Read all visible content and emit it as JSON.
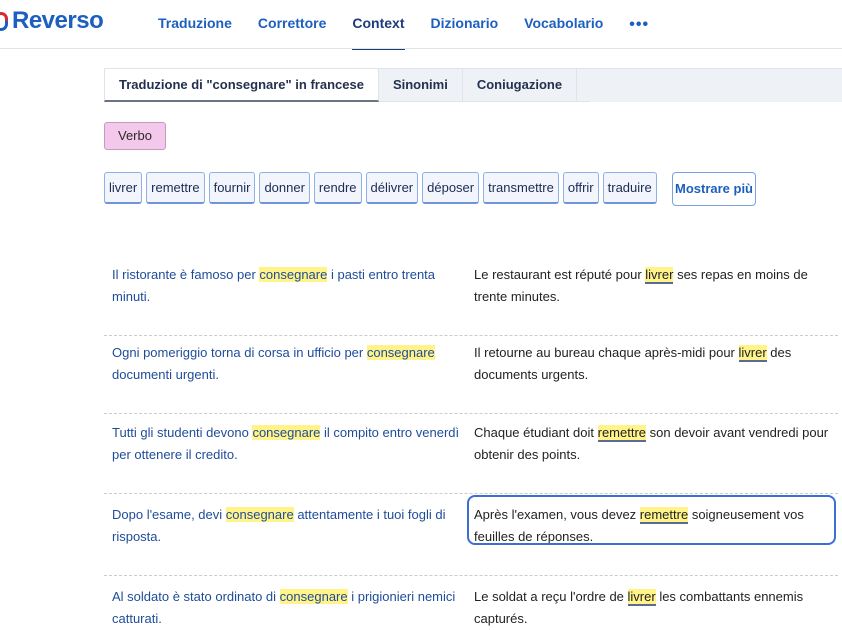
{
  "brand": {
    "name": "Reverso"
  },
  "nav": {
    "items": [
      "Traduzione",
      "Correttore",
      "Context",
      "Dizionario",
      "Vocabolario"
    ],
    "active": "Context",
    "more_label": "•••"
  },
  "subtabs": {
    "items": [
      "Traduzione di \"consegnare\" in francese",
      "Sinonimi",
      "Coniugazione"
    ],
    "more_label": "···"
  },
  "pos_label": "Verbo",
  "translations": [
    "livrer",
    "remettre",
    "fournir",
    "donner",
    "rendre",
    "délivrer",
    "déposer",
    "transmettre",
    "offrir",
    "traduire"
  ],
  "more_button": "Mostrare più",
  "examples": [
    {
      "src_before": "Il ristorante è famoso per ",
      "src_term": "consegnare",
      "src_after": " i pasti entro trenta minuti.",
      "trg_before": "Le restaurant est réputé pour ",
      "trg_term": "livrer",
      "trg_after": " ses repas en moins de trente minutes."
    },
    {
      "src_before": "Ogni pomeriggio torna di corsa in ufficio per ",
      "src_term": "consegnare",
      "src_after": " documenti urgenti.",
      "trg_before": "Il retourne au bureau chaque après-midi pour ",
      "trg_term": "livrer",
      "trg_after": " des documents urgents."
    },
    {
      "src_before": "Tutti gli studenti devono ",
      "src_term": "consegnare",
      "src_after": " il compito entro venerdì per ottenere il credito.",
      "trg_before": "Chaque étudiant doit ",
      "trg_term": "remettre",
      "trg_after": " son devoir avant vendredi pour obtenir des points."
    },
    {
      "src_before": "Dopo l'esame, devi ",
      "src_term": "consegnare",
      "src_after": " attentamente i tuoi fogli di risposta.",
      "trg_before": "Après l'examen, vous devez ",
      "trg_term": "remettre",
      "trg_after": " soigneusement vos feuilles de réponses."
    },
    {
      "src_before": "Al soldato è stato ordinato di ",
      "src_term": "consegnare",
      "src_after": " i prigionieri nemici catturati.",
      "trg_before": "Le soldat a reçu l'ordre de ",
      "trg_term": "livrer",
      "trg_after": " les combattants ennemis capturés."
    }
  ]
}
